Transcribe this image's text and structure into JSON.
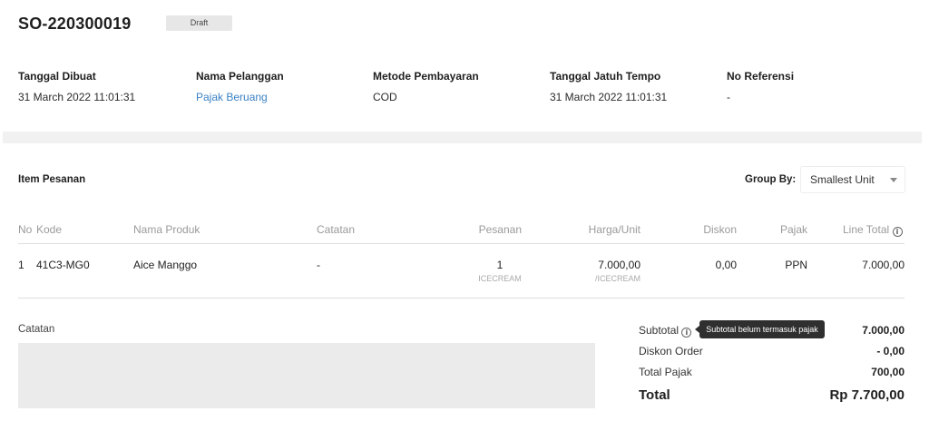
{
  "order": {
    "id": "SO-220300019",
    "status": "Draft"
  },
  "info": {
    "created_label": "Tanggal Dibuat",
    "created_value": "31 March 2022 11:01:31",
    "customer_label": "Nama Pelanggan",
    "customer_value": "Pajak Beruang",
    "payment_label": "Metode Pembayaran",
    "payment_value": "COD",
    "due_label": "Tanggal Jatuh Tempo",
    "due_value": "31 March 2022 11:01:31",
    "ref_label": "No Referensi",
    "ref_value": "-"
  },
  "items": {
    "title": "Item Pesanan",
    "group_by_label": "Group By:",
    "group_by_value": "Smallest Unit",
    "columns": {
      "no": "No",
      "kode": "Kode",
      "nama": "Nama Produk",
      "catatan": "Catatan",
      "pesanan": "Pesanan",
      "harga": "Harga/Unit",
      "diskon": "Diskon",
      "pajak": "Pajak",
      "line_total": "Line Total"
    },
    "rows": [
      {
        "no": "1",
        "kode": "41C3-MG0",
        "nama": "Aice Manggo",
        "catatan": "-",
        "qty": "1",
        "qty_unit": "ICECREAM",
        "harga": "7.000,00",
        "harga_unit": "/ICECREAM",
        "diskon": "0,00",
        "pajak": "PPN",
        "line_total": "7.000,00"
      }
    ]
  },
  "notes": {
    "label": "Catatan"
  },
  "summary": {
    "subtotal_label": "Subtotal",
    "subtotal_value": "7.000,00",
    "subtotal_tooltip": "Subtotal belum termasuk pajak",
    "discount_label": "Diskon Order",
    "discount_value": "- 0,00",
    "tax_label": "Total Pajak",
    "tax_value": "700,00",
    "total_label": "Total",
    "total_value": "Rp 7.700,00"
  },
  "icons": {
    "info": "info-circle-icon",
    "caret": "chevron-down-icon"
  },
  "colors": {
    "link": "#3b82c4",
    "badge_bg": "#e7e7e7",
    "tooltip_bg": "#2f2f2f"
  }
}
